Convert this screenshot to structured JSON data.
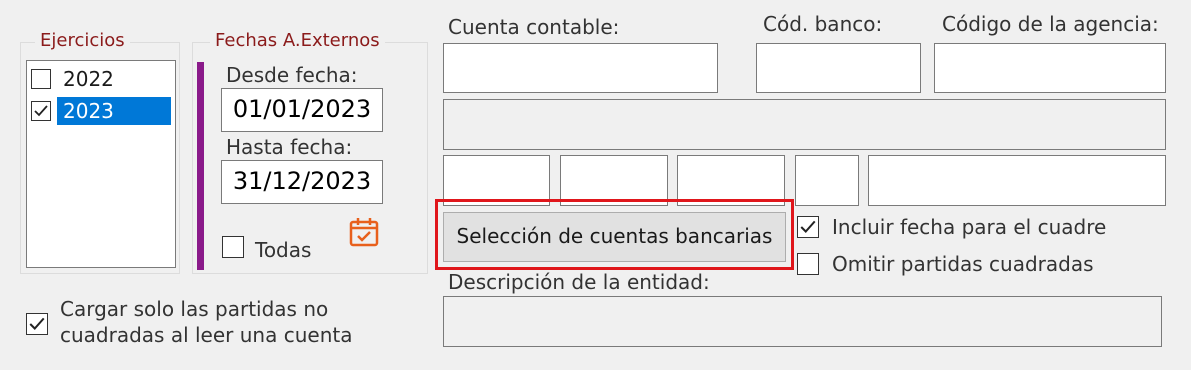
{
  "ejercicios": {
    "legend": "Ejercicios",
    "items": [
      {
        "label": "2022",
        "checked": false,
        "selected": false
      },
      {
        "label": "2023",
        "checked": true,
        "selected": true
      }
    ]
  },
  "fechas": {
    "legend": "Fechas A.Externos",
    "desde_label": "Desde fecha:",
    "desde_value": "01/01/2023",
    "hasta_label": "Hasta fecha:",
    "hasta_value": "31/12/2023",
    "todas_label": "Todas",
    "todas_checked": false
  },
  "cuenta": {
    "cuenta_contable_label": "Cuenta contable:",
    "cod_banco_label": "Cód. banco:",
    "codigo_agencia_label": "Código de la agencia:"
  },
  "seleccion_button": "Selección de cuentas bancarias",
  "options": {
    "incluir_fecha_label": "Incluir fecha para el cuadre",
    "incluir_fecha_checked": true,
    "omitir_partidas_label": "Omitir partidas cuadradas",
    "omitir_partidas_checked": false
  },
  "descripcion_label": "Descripción de la entidad:",
  "cargar": {
    "label_line1": "Cargar solo las partidas no",
    "label_line2": "cuadradas al leer una cuenta",
    "checked": true
  },
  "colors": {
    "legend": "#8b1b1b",
    "selection": "#0078d7",
    "accent_bar": "#8a1a8a",
    "highlight": "#e0161b",
    "calendar": "#e8601c"
  },
  "icons": [
    "calendar-icon",
    "checkmark-icon"
  ]
}
